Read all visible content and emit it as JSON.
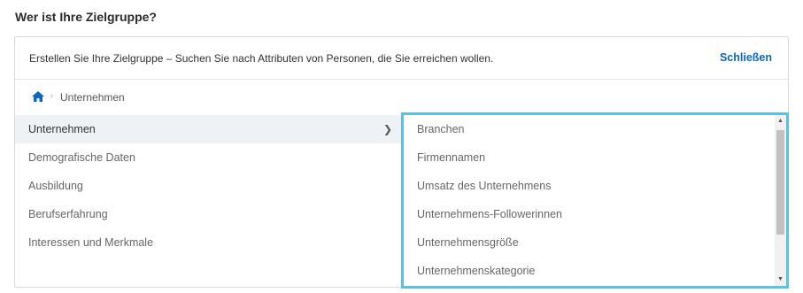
{
  "heading": "Wer ist Ihre Zielgruppe?",
  "panel": {
    "description": "Erstellen Sie Ihre Zielgruppe – Suchen Sie nach Attributen von Personen, die Sie erreichen wollen.",
    "close_label": "Schließen"
  },
  "breadcrumb": {
    "home_icon": "home-icon",
    "separator": "›",
    "current": "Unternehmen"
  },
  "categories": [
    {
      "label": "Unternehmen",
      "selected": true,
      "chevron": "❯"
    },
    {
      "label": "Demografische Daten"
    },
    {
      "label": "Ausbildung"
    },
    {
      "label": "Berufserfahrung"
    },
    {
      "label": "Interessen und Merkmale"
    }
  ],
  "subcategories": [
    {
      "label": "Branchen"
    },
    {
      "label": "Firmennamen"
    },
    {
      "label": "Umsatz des Unternehmens"
    },
    {
      "label": "Unternehmens-Followerinnen"
    },
    {
      "label": "Unternehmensgröße"
    },
    {
      "label": "Unternehmenskategorie"
    }
  ],
  "scrollbar": {
    "up_arrow": "▲",
    "down_arrow": "▼"
  },
  "colors": {
    "accent": "#0a66c2",
    "highlight_border": "#5bbfe6",
    "selected_bg": "#eef2f6"
  }
}
